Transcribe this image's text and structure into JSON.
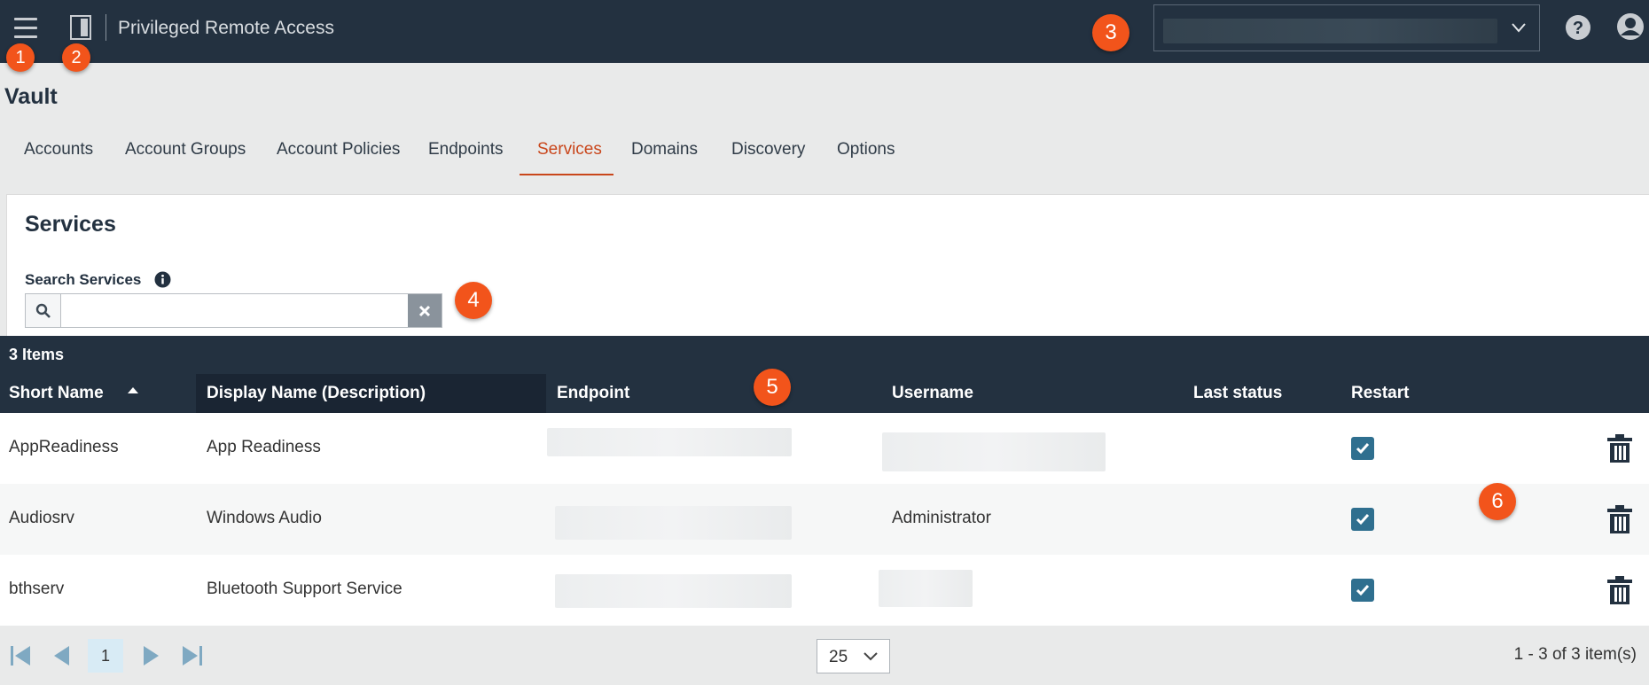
{
  "header": {
    "app_title": "Privileged Remote Access",
    "icons": {
      "menu": "hamburger-menu-icon",
      "app": "door-icon",
      "dropdown": "chevron-down-icon",
      "help": "help-icon",
      "user": "user-account-icon"
    }
  },
  "callouts": [
    "1",
    "2",
    "3",
    "4",
    "5",
    "6"
  ],
  "page": {
    "title": "Vault"
  },
  "tabs": [
    {
      "label": "Accounts",
      "active": false
    },
    {
      "label": "Account Groups",
      "active": false
    },
    {
      "label": "Account Policies",
      "active": false
    },
    {
      "label": "Endpoints",
      "active": false
    },
    {
      "label": "Services",
      "active": true
    },
    {
      "label": "Domains",
      "active": false
    },
    {
      "label": "Discovery",
      "active": false
    },
    {
      "label": "Options",
      "active": false
    }
  ],
  "panel": {
    "title": "Services",
    "search_label": "Search Services",
    "search_value": "",
    "icons": {
      "info": "info-icon",
      "search": "search-icon",
      "clear": "close-icon"
    }
  },
  "table": {
    "count": "3 Items",
    "columns": [
      "Short Name",
      "Display Name (Description)",
      "Endpoint",
      "Username",
      "Last status",
      "Restart"
    ],
    "sorted_by": "Short Name",
    "rows": [
      {
        "short_name": "AppReadiness",
        "display_name": "App Readiness",
        "endpoint": "",
        "username": "",
        "last_status": "",
        "restart": true
      },
      {
        "short_name": "Audiosrv",
        "display_name": "Windows Audio",
        "endpoint": "",
        "username": "Administrator",
        "last_status": "",
        "restart": true
      },
      {
        "short_name": "bthserv",
        "display_name": "Bluetooth Support Service",
        "endpoint": "",
        "username": "",
        "last_status": "",
        "restart": true
      }
    ]
  },
  "pagination": {
    "current_page": "1",
    "page_size": "25",
    "info": "1 - 3 of 3 item(s)"
  },
  "colors": {
    "header_bg": "#233140",
    "accent": "#c9461b",
    "callout": "#f2541b",
    "checkbox": "#2f6f8f"
  }
}
